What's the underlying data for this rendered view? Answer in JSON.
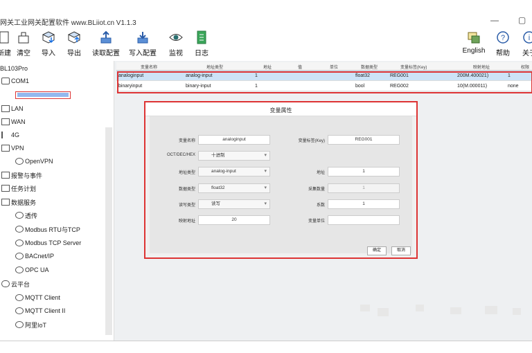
{
  "window": {
    "title": "网关工业网关配置软件 www.BLiiot.cn V1.1.3",
    "minimize_glyph": "—",
    "maximize_glyph": "▢"
  },
  "toolbar": {
    "left": [
      {
        "label": "新建",
        "icon": "new-file-icon"
      },
      {
        "label": "清空",
        "icon": "clear-icon"
      },
      {
        "label": "导入",
        "icon": "import-icon"
      },
      {
        "label": "导出",
        "icon": "export-icon"
      },
      {
        "label": "读取配置",
        "icon": "read-config-icon"
      },
      {
        "label": "写入配置",
        "icon": "write-config-icon"
      },
      {
        "label": "监视",
        "icon": "monitor-eye-icon"
      },
      {
        "label": "日志",
        "icon": "log-icon"
      }
    ],
    "right": [
      {
        "label": "English",
        "icon": "language-icon"
      },
      {
        "label": "帮助",
        "icon": "help-icon"
      },
      {
        "label": "关于",
        "icon": "about-icon"
      }
    ]
  },
  "sidebar": {
    "root": "BL103Pro",
    "items": [
      {
        "label": "COM1",
        "level": 1
      },
      {
        "label": "LAN",
        "level": 1
      },
      {
        "label": "WAN",
        "level": 1
      },
      {
        "label": "4G",
        "level": 1
      },
      {
        "label": "VPN",
        "level": 1
      },
      {
        "label": "OpenVPN",
        "level": 2
      },
      {
        "label": "报警与事件",
        "level": 1
      },
      {
        "label": "任务计划",
        "level": 1
      },
      {
        "label": "数据服务",
        "level": 1
      },
      {
        "label": "透传",
        "level": 2
      },
      {
        "label": "Modbus RTU与TCP",
        "level": 2
      },
      {
        "label": "Modbus TCP Server",
        "level": 2
      },
      {
        "label": "BACnet/IP",
        "level": 2
      },
      {
        "label": "OPC UA",
        "level": 2
      },
      {
        "label": "云平台",
        "level": 1
      },
      {
        "label": "MQTT Client",
        "level": 2
      },
      {
        "label": "MQTT Client II",
        "level": 2
      },
      {
        "label": "阿里IoT",
        "level": 2
      }
    ]
  },
  "grid": {
    "columns": [
      "变量名称",
      "地址类型",
      "地址",
      "值",
      "单位",
      "数据类型",
      "变量标签(Key)",
      "映射地址",
      "",
      "权限"
    ],
    "rows": [
      [
        "analoginput",
        "analog-input",
        "1",
        "",
        "",
        "float32",
        "REG001",
        "200M.400021)",
        "1",
        ""
      ],
      [
        "binaryinput",
        "binary-input",
        "1",
        "",
        "",
        "bool",
        "REG002",
        "10(M.000011)",
        "none",
        ""
      ]
    ]
  },
  "dialog": {
    "title": "变量属性",
    "left_fields": [
      {
        "label": "变量名称",
        "value": "analoginput",
        "type": "text"
      },
      {
        "label": "OCT/DEC/HEX",
        "value": "十进制",
        "type": "dropdown"
      },
      {
        "label": "地址类型",
        "value": "analog-input",
        "type": "dropdown"
      },
      {
        "label": "数据类型",
        "value": "float32",
        "type": "dropdown"
      },
      {
        "label": "读写类型",
        "value": "读写",
        "type": "dropdown"
      },
      {
        "label": "映射地址",
        "value": "20",
        "type": "text"
      }
    ],
    "right_fields": [
      {
        "label": "变量标签(Key)",
        "value": "REG001",
        "type": "text"
      },
      {
        "label": "地址",
        "value": "1",
        "type": "text"
      },
      {
        "label": "采集数量",
        "value": "1",
        "type": "disabled"
      },
      {
        "label": "系数",
        "value": "1",
        "type": "text"
      },
      {
        "label": "变量单位",
        "value": "",
        "type": "text"
      }
    ],
    "ok": "确定",
    "cancel": "取消"
  },
  "colors": {
    "highlight_red": "#dd3333",
    "selection_blue": "#cde3f7"
  }
}
